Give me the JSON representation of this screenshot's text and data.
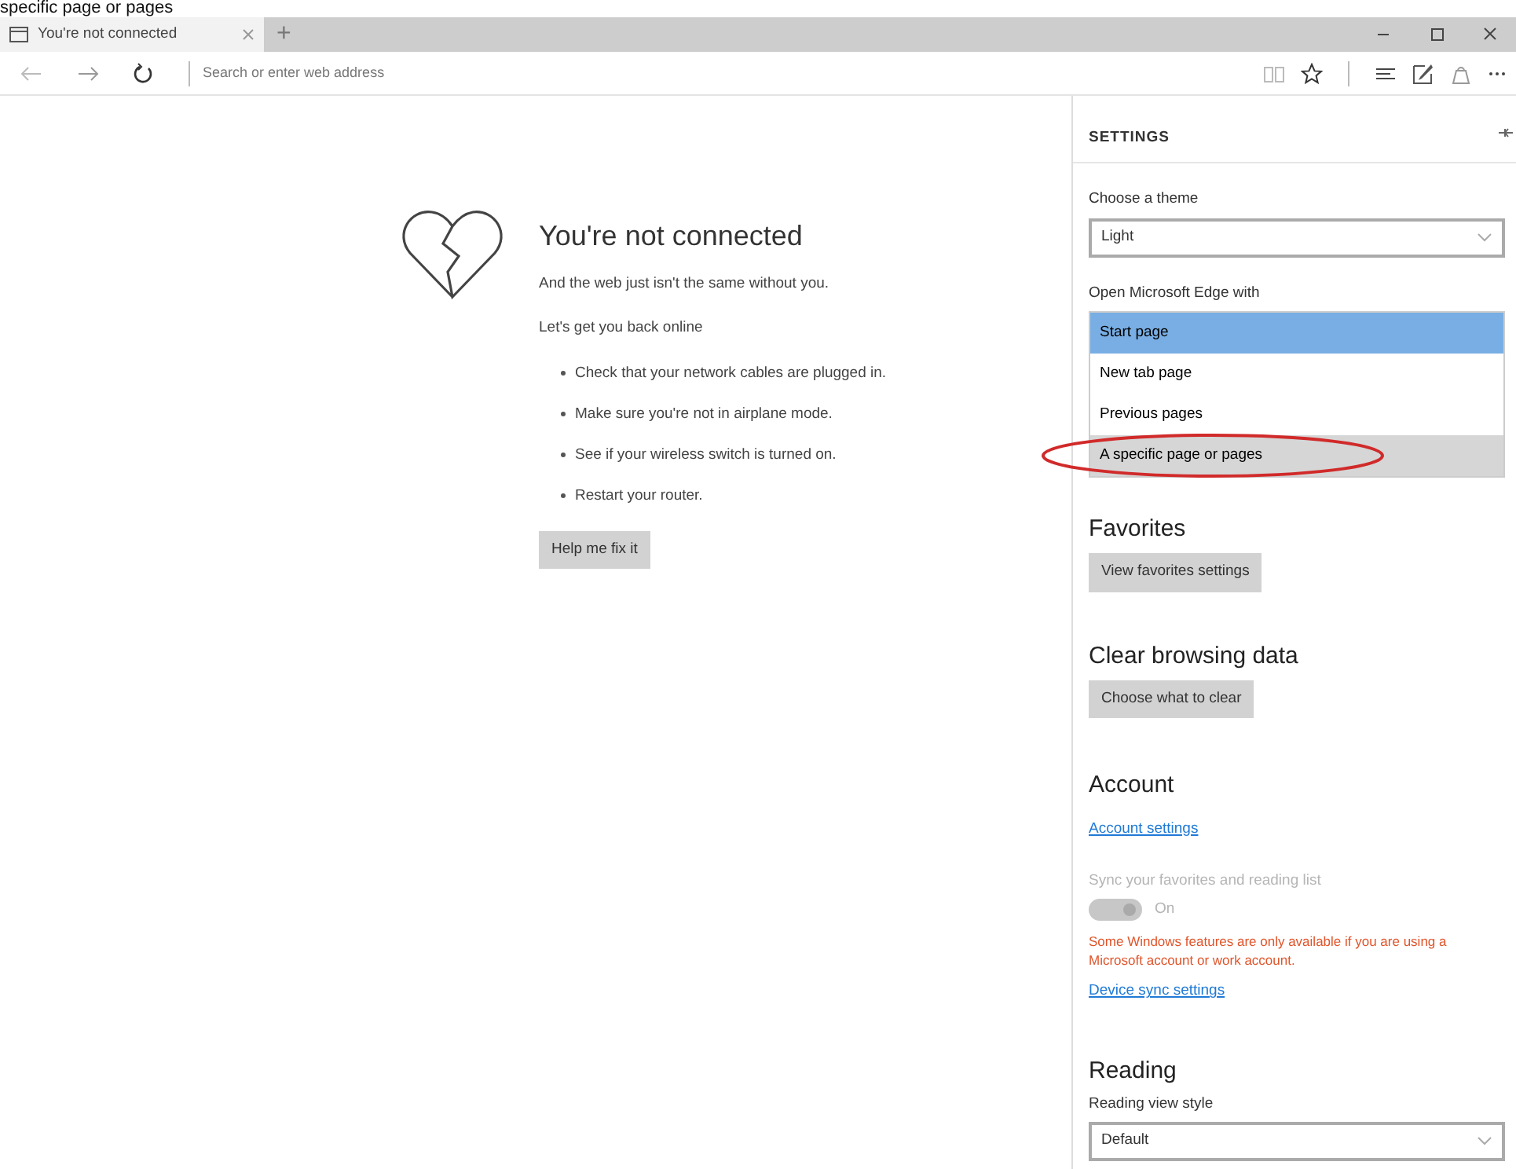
{
  "clipped_caption": "specific page or pages",
  "tabs": [
    {
      "label": "You're not connected",
      "selected": true
    }
  ],
  "new_tab": "+",
  "address_bar": {
    "placeholder": "Search or enter web address"
  },
  "error_page": {
    "title": "You're not connected",
    "subtitle": "And the web just isn't the same without you.",
    "intro": "Let's get you back online",
    "tips": [
      "Check that your network cables are plugged in.",
      "Make sure you're not in airplane mode.",
      "See if your wireless switch is turned on.",
      "Restart your router."
    ],
    "button": "Help me fix it"
  },
  "settings": {
    "title": "SETTINGS",
    "theme": {
      "label": "Choose a theme",
      "value": "Light"
    },
    "open_with": {
      "label": "Open Microsoft Edge with",
      "options": [
        {
          "label": "Start page",
          "selected": true,
          "hovered": false,
          "circled": false
        },
        {
          "label": "New tab page",
          "selected": false,
          "hovered": false,
          "circled": false
        },
        {
          "label": "Previous pages",
          "selected": false,
          "hovered": false,
          "circled": false
        },
        {
          "label": "A specific page or pages",
          "selected": false,
          "hovered": true,
          "circled": true
        }
      ]
    },
    "favorites": {
      "heading": "Favorites",
      "button": "View favorites settings"
    },
    "clear": {
      "heading": "Clear browsing data",
      "button": "Choose what to clear"
    },
    "account": {
      "heading": "Account",
      "link": "Account settings"
    },
    "sync": {
      "label": "Sync your favorites and reading list",
      "on": true,
      "disabled": true,
      "state_label": "On"
    },
    "warning": "Some Windows features are only available if you are using a Microsoft account or work account.",
    "sync_link": "Device sync settings",
    "reading": {
      "heading": "Reading",
      "label": "Reading view style",
      "value": "Default"
    }
  }
}
